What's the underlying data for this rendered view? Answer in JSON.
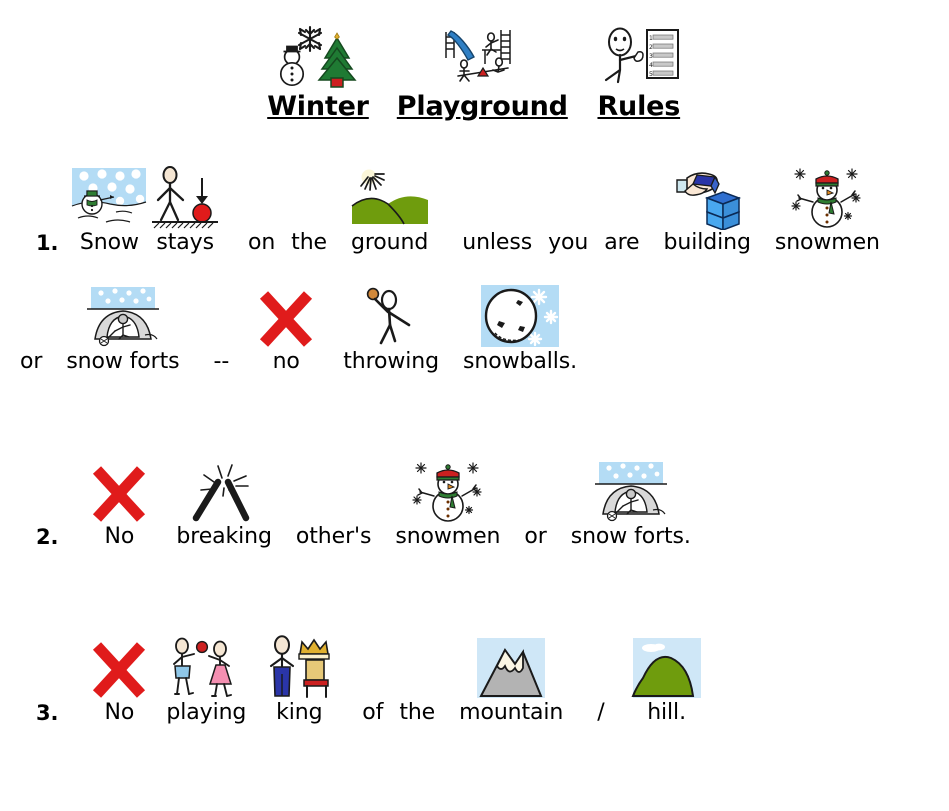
{
  "document": {
    "title_words": [
      {
        "label": "Winter",
        "icon": "winter-snowman-tree-icon"
      },
      {
        "label": "Playground",
        "icon": "playground-slide-seesaw-icon"
      },
      {
        "label": "Rules",
        "icon": "rules-person-list-icon"
      }
    ]
  },
  "rules": [
    {
      "number": "1.",
      "lines": [
        {
          "tokens": [
            {
              "text": "Snow",
              "icon": "snowy-scene-icon"
            },
            {
              "text": "stays",
              "icon": "stays-falling-ball-icon"
            },
            {
              "text": "on",
              "icon": null
            },
            {
              "text": "the",
              "icon": null
            },
            {
              "text": "ground",
              "icon": "sun-over-green-hills-icon"
            },
            {
              "text": "unless",
              "icon": null
            },
            {
              "text": "you",
              "icon": null
            },
            {
              "text": "are",
              "icon": null
            },
            {
              "text": "building",
              "icon": "hand-stacking-blocks-icon"
            },
            {
              "text": "snowmen",
              "icon": "snowman-snowflakes-icon"
            }
          ]
        },
        {
          "tokens": [
            {
              "text": "or",
              "icon": null
            },
            {
              "text": "snow forts",
              "icon": "snow-fort-icon"
            },
            {
              "text": "--",
              "icon": null
            },
            {
              "text": "no",
              "icon": "red-x-icon"
            },
            {
              "text": "throwing",
              "icon": "person-throwing-icon"
            },
            {
              "text": "snowballs.",
              "icon": "snowball-icon"
            }
          ]
        }
      ]
    },
    {
      "number": "2.",
      "lines": [
        {
          "tokens": [
            {
              "text": "No",
              "icon": "red-x-icon"
            },
            {
              "text": "breaking",
              "icon": "breaking-sticks-icon"
            },
            {
              "text": "other's",
              "icon": null
            },
            {
              "text": "snowmen",
              "icon": "snowman-snowflakes-icon"
            },
            {
              "text": "or",
              "icon": null
            },
            {
              "text": "snow forts.",
              "icon": "snow-fort-icon"
            }
          ]
        }
      ]
    },
    {
      "number": "3.",
      "lines": [
        {
          "tokens": [
            {
              "text": "No",
              "icon": "red-x-icon"
            },
            {
              "text": "playing",
              "icon": "two-kids-ball-icon"
            },
            {
              "text": "king",
              "icon": "king-crown-throne-icon"
            },
            {
              "text": "of",
              "icon": null
            },
            {
              "text": "the",
              "icon": null
            },
            {
              "text": "mountain",
              "icon": "mountain-icon"
            },
            {
              "text": "/",
              "icon": null
            },
            {
              "text": "hill.",
              "icon": "green-hill-icon"
            }
          ]
        }
      ]
    }
  ],
  "colors": {
    "red_x": "#e01b1b",
    "sky_blue": "#b4dcf5",
    "grass_green": "#6f9c0d",
    "tree_green": "#1f7a33",
    "block_blue": "#2196f3",
    "mountain_grey": "#b3b3b3",
    "hat_red": "#d32f2f",
    "scarf_green": "#2e7d32",
    "skin": "#f5e6d3",
    "pink": "#f48fb1",
    "navy": "#2a35a8",
    "gold": "#e0b030"
  }
}
